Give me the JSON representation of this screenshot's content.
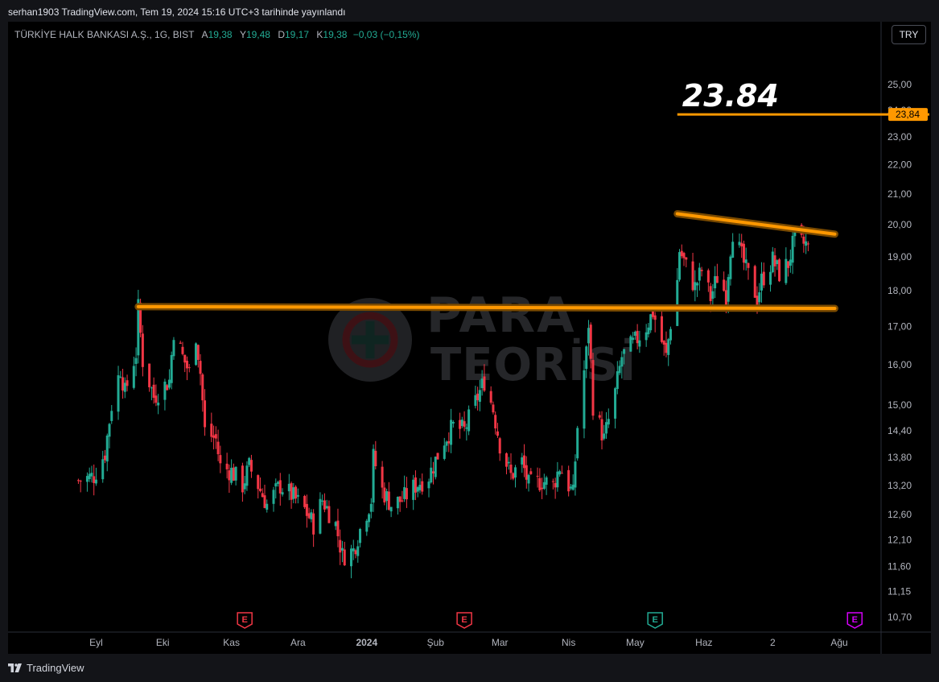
{
  "header": {
    "publish_text": "serhan1903 TradingView.com, Tem 19, 2024 15:16 UTC+3 tarihinde yayınlandı"
  },
  "legend": {
    "symbol": "TÜRKİYE HALK BANKASI A.Ş., 1G, BIST",
    "open_label": "A",
    "open_value": "19,38",
    "high_label": "Y",
    "high_value": "19,48",
    "low_label": "D",
    "low_value": "19,17",
    "close_label": "K",
    "close_value": "19,38",
    "change": "−0,03 (−0,15%)"
  },
  "currency_button": "TRY",
  "footer": {
    "brand": "TradingView"
  },
  "watermark": {
    "line1": "PARA",
    "line2": "TEORİSİ"
  },
  "colors": {
    "up": "#22ab94",
    "down": "#f23645",
    "orange": "#ff9800",
    "background": "#000000"
  },
  "chart_data": {
    "type": "candlestick",
    "y_scale": "log",
    "y_ticks": [
      {
        "label": "25,00",
        "value": 25.0
      },
      {
        "label": "24,00",
        "value": 24.0
      },
      {
        "label": "23,00",
        "value": 23.0
      },
      {
        "label": "22,00",
        "value": 22.0
      },
      {
        "label": "21,00",
        "value": 21.0
      },
      {
        "label": "20,00",
        "value": 20.0
      },
      {
        "label": "19,00",
        "value": 19.0
      },
      {
        "label": "18,00",
        "value": 18.0
      },
      {
        "label": "17,00",
        "value": 17.0
      },
      {
        "label": "16,00",
        "value": 16.0
      },
      {
        "label": "15,00",
        "value": 15.0
      },
      {
        "label": "14,40",
        "value": 14.4
      },
      {
        "label": "13,80",
        "value": 13.8
      },
      {
        "label": "13,20",
        "value": 13.2
      },
      {
        "label": "12,60",
        "value": 12.6
      },
      {
        "label": "12,10",
        "value": 12.1
      },
      {
        "label": "11,60",
        "value": 11.6
      },
      {
        "label": "11,15",
        "value": 11.15
      },
      {
        "label": "10,70",
        "value": 10.7
      }
    ],
    "x_ticks": [
      {
        "label": "Eyl",
        "date": "2023-09-01",
        "bold": false
      },
      {
        "label": "Eki",
        "date": "2023-10-01",
        "bold": false
      },
      {
        "label": "Kas",
        "date": "2023-11-01",
        "bold": false
      },
      {
        "label": "Ara",
        "date": "2023-12-01",
        "bold": false
      },
      {
        "label": "2024",
        "date": "2024-01-01",
        "bold": true
      },
      {
        "label": "Şub",
        "date": "2024-02-01",
        "bold": false
      },
      {
        "label": "Mar",
        "date": "2024-03-01",
        "bold": false
      },
      {
        "label": "Nis",
        "date": "2024-04-01",
        "bold": false
      },
      {
        "label": "May",
        "date": "2024-05-01",
        "bold": false
      },
      {
        "label": "Haz",
        "date": "2024-06-01",
        "bold": false
      },
      {
        "label": "2",
        "date": "2024-07-02",
        "bold": false
      },
      {
        "label": "Ağu",
        "date": "2024-08-01",
        "bold": false
      }
    ],
    "anchors": [
      {
        "date": "2023-08-24",
        "close": 13.3
      },
      {
        "date": "2023-08-31",
        "close": 13.4
      },
      {
        "date": "2023-09-05",
        "close": 13.9
      },
      {
        "date": "2023-09-08",
        "close": 15.0
      },
      {
        "date": "2023-09-12",
        "close": 15.9
      },
      {
        "date": "2023-09-14",
        "close": 15.3
      },
      {
        "date": "2023-09-19",
        "close": 16.3
      },
      {
        "date": "2023-09-20",
        "close": 17.5
      },
      {
        "date": "2023-09-22",
        "close": 16.1
      },
      {
        "date": "2023-09-27",
        "close": 15.2
      },
      {
        "date": "2023-10-04",
        "close": 15.6
      },
      {
        "date": "2023-10-06",
        "close": 16.9
      },
      {
        "date": "2023-10-10",
        "close": 16.2
      },
      {
        "date": "2023-10-13",
        "close": 15.8
      },
      {
        "date": "2023-10-16",
        "close": 16.8
      },
      {
        "date": "2023-10-18",
        "close": 15.8
      },
      {
        "date": "2023-10-20",
        "close": 14.4
      },
      {
        "date": "2023-10-25",
        "close": 14.2
      },
      {
        "date": "2023-10-27",
        "close": 13.6
      },
      {
        "date": "2023-11-01",
        "close": 13.5
      },
      {
        "date": "2023-11-06",
        "close": 13.2
      },
      {
        "date": "2023-11-09",
        "close": 13.6
      },
      {
        "date": "2023-11-14",
        "close": 13.1
      },
      {
        "date": "2023-11-17",
        "close": 12.8
      },
      {
        "date": "2023-11-23",
        "close": 13.2
      },
      {
        "date": "2023-11-28",
        "close": 13.0
      },
      {
        "date": "2023-12-04",
        "close": 12.7
      },
      {
        "date": "2023-12-08",
        "close": 12.4
      },
      {
        "date": "2023-12-12",
        "close": 12.9
      },
      {
        "date": "2023-12-18",
        "close": 12.4
      },
      {
        "date": "2023-12-21",
        "close": 11.8
      },
      {
        "date": "2023-12-26",
        "close": 11.9
      },
      {
        "date": "2023-12-29",
        "close": 12.3
      },
      {
        "date": "2024-01-03",
        "close": 12.9
      },
      {
        "date": "2024-01-04",
        "close": 13.8
      },
      {
        "date": "2024-01-08",
        "close": 13.1
      },
      {
        "date": "2024-01-12",
        "close": 12.8
      },
      {
        "date": "2024-01-17",
        "close": 12.9
      },
      {
        "date": "2024-01-23",
        "close": 13.2
      },
      {
        "date": "2024-01-29",
        "close": 13.4
      },
      {
        "date": "2024-02-05",
        "close": 14.2
      },
      {
        "date": "2024-02-09",
        "close": 14.5
      },
      {
        "date": "2024-02-14",
        "close": 14.4
      },
      {
        "date": "2024-02-20",
        "close": 15.2
      },
      {
        "date": "2024-02-23",
        "close": 15.6
      },
      {
        "date": "2024-02-27",
        "close": 14.9
      },
      {
        "date": "2024-03-01",
        "close": 14.1
      },
      {
        "date": "2024-03-06",
        "close": 13.4
      },
      {
        "date": "2024-03-11",
        "close": 13.7
      },
      {
        "date": "2024-03-14",
        "close": 13.2
      },
      {
        "date": "2024-03-20",
        "close": 13.3
      },
      {
        "date": "2024-03-25",
        "close": 13.2
      },
      {
        "date": "2024-03-28",
        "close": 13.6
      },
      {
        "date": "2024-04-03",
        "close": 13.0
      },
      {
        "date": "2024-04-05",
        "close": 14.5
      },
      {
        "date": "2024-04-09",
        "close": 16.3
      },
      {
        "date": "2024-04-10",
        "close": 17.1
      },
      {
        "date": "2024-04-12",
        "close": 15.0
      },
      {
        "date": "2024-04-17",
        "close": 14.2
      },
      {
        "date": "2024-04-22",
        "close": 15.3
      },
      {
        "date": "2024-04-25",
        "close": 16.2
      },
      {
        "date": "2024-05-01",
        "close": 16.6
      },
      {
        "date": "2024-05-06",
        "close": 17.0
      },
      {
        "date": "2024-05-09",
        "close": 17.4
      },
      {
        "date": "2024-05-13",
        "close": 16.6
      },
      {
        "date": "2024-05-15",
        "close": 16.2
      },
      {
        "date": "2024-05-17",
        "close": 17.1
      },
      {
        "date": "2024-05-20",
        "close": 18.3
      },
      {
        "date": "2024-05-21",
        "close": 19.2
      },
      {
        "date": "2024-05-24",
        "close": 18.7
      },
      {
        "date": "2024-05-28",
        "close": 18.1
      },
      {
        "date": "2024-05-31",
        "close": 18.6
      },
      {
        "date": "2024-06-04",
        "close": 17.8
      },
      {
        "date": "2024-06-07",
        "close": 18.4
      },
      {
        "date": "2024-06-11",
        "close": 17.9
      },
      {
        "date": "2024-06-13",
        "close": 19.3
      },
      {
        "date": "2024-06-14",
        "close": 19.8
      },
      {
        "date": "2024-06-20",
        "close": 18.6
      },
      {
        "date": "2024-06-25",
        "close": 17.8
      },
      {
        "date": "2024-06-27",
        "close": 18.3
      },
      {
        "date": "2024-07-02",
        "close": 18.9
      },
      {
        "date": "2024-07-05",
        "close": 18.5
      },
      {
        "date": "2024-07-09",
        "close": 18.8
      },
      {
        "date": "2024-07-12",
        "close": 19.6
      },
      {
        "date": "2024-07-15",
        "close": 19.4
      },
      {
        "date": "2024-07-18",
        "close": 19.38
      }
    ],
    "drawings": [
      {
        "kind": "segment",
        "name": "support-line",
        "color": "#ff9800",
        "points": [
          {
            "date": "2023-09-20",
            "price": 17.55
          },
          {
            "date": "2024-07-30",
            "price": 17.5
          }
        ]
      },
      {
        "kind": "segment",
        "name": "descending-resistance-line",
        "color": "#ff9800",
        "points": [
          {
            "date": "2024-05-20",
            "price": 20.35
          },
          {
            "date": "2024-07-30",
            "price": 19.7
          }
        ]
      },
      {
        "kind": "segment",
        "name": "target-line",
        "color": "#ff9800",
        "points": [
          {
            "date": "2024-05-20",
            "price": 23.84
          },
          {
            "date": "2024-08-20",
            "price": 23.84
          }
        ]
      }
    ],
    "target_label": "23.84",
    "target_price_tag": "23,84",
    "earnings_markers": [
      {
        "date": "2023-11-07",
        "letter": "E",
        "color": "#f23645"
      },
      {
        "date": "2024-02-14",
        "letter": "E",
        "color": "#f23645"
      },
      {
        "date": "2024-05-10",
        "letter": "E",
        "color": "#22ab94"
      },
      {
        "date": "2024-08-08",
        "letter": "E",
        "color": "#d500f9"
      }
    ]
  }
}
